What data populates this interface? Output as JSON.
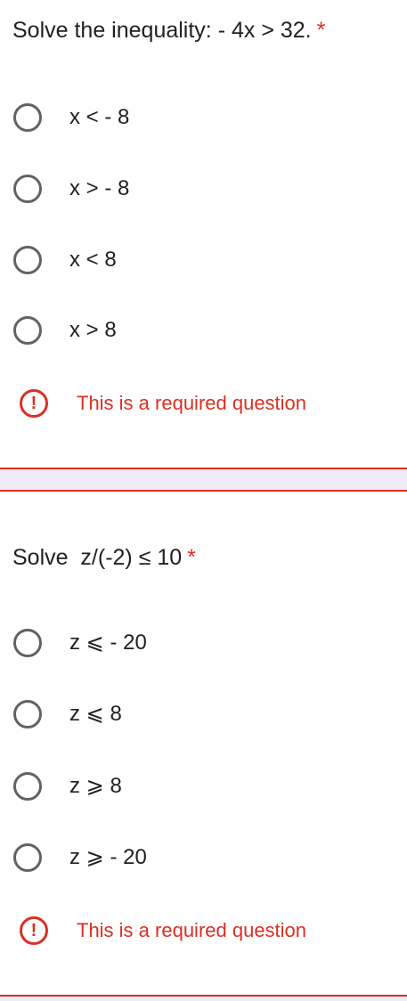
{
  "questions": [
    {
      "title": "Solve the inequality: - 4x > 32.",
      "required_mark": "*",
      "options": [
        "x < - 8",
        "x > - 8",
        "x < 8",
        "x > 8"
      ],
      "error_icon": "!",
      "error": "This is a required question"
    },
    {
      "title": "Solve  z/(-2) ≤ 10",
      "required_mark": "*",
      "options": [
        "z ⩽ - 20",
        "z ⩽ 8",
        "z ⩾ 8",
        "z ⩾ - 20"
      ],
      "error_icon": "!",
      "error": "This is a required question"
    }
  ],
  "colors": {
    "text": "#202124",
    "error": "#d93025",
    "radio_border": "#5f6368",
    "section_gap": "#f0ebf8"
  }
}
